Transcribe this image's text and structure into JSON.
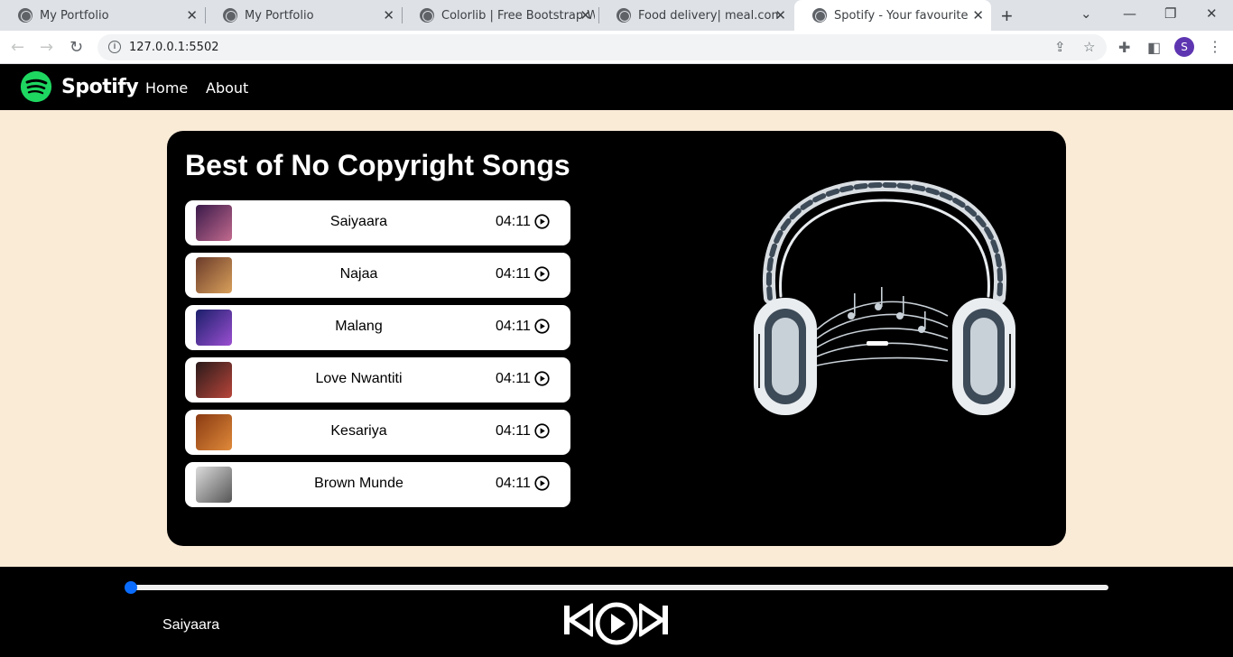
{
  "browser": {
    "tabs": [
      {
        "title": "My Portfolio",
        "active": false
      },
      {
        "title": "My Portfolio",
        "active": false
      },
      {
        "title": "Colorlib | Free Bootstrap Web",
        "active": false
      },
      {
        "title": "Food delivery| meal.com",
        "active": false
      },
      {
        "title": "Spotify - Your favourite music",
        "active": true
      }
    ],
    "url": "127.0.0.1:5502",
    "profile_initial": "S"
  },
  "nav": {
    "brand": "Spotify",
    "links": [
      "Home",
      "About"
    ]
  },
  "main": {
    "title": "Best of No Copyright Songs",
    "songs": [
      {
        "name": "Saiyaara",
        "duration": "04:11",
        "cover_colors": [
          "#3a1a4a",
          "#c26a8e"
        ]
      },
      {
        "name": "Najaa",
        "duration": "04:11",
        "cover_colors": [
          "#6b3b2a",
          "#d9a05b"
        ]
      },
      {
        "name": "Malang",
        "duration": "04:11",
        "cover_colors": [
          "#1b1f6b",
          "#9b4fd1"
        ]
      },
      {
        "name": "Love Nwantiti",
        "duration": "04:11",
        "cover_colors": [
          "#2a1a1a",
          "#b8453a"
        ]
      },
      {
        "name": "Kesariya",
        "duration": "04:11",
        "cover_colors": [
          "#8a3a12",
          "#e08a3a"
        ]
      },
      {
        "name": "Brown Munde",
        "duration": "04:11",
        "cover_colors": [
          "#dcdcdc",
          "#555555"
        ]
      }
    ]
  },
  "player": {
    "now_playing": "Saiyaara",
    "progress": 0,
    "accent": "#0a6cff"
  },
  "colors": {
    "page_bg": "#faebd7",
    "spotify_green": "#1ed760"
  }
}
